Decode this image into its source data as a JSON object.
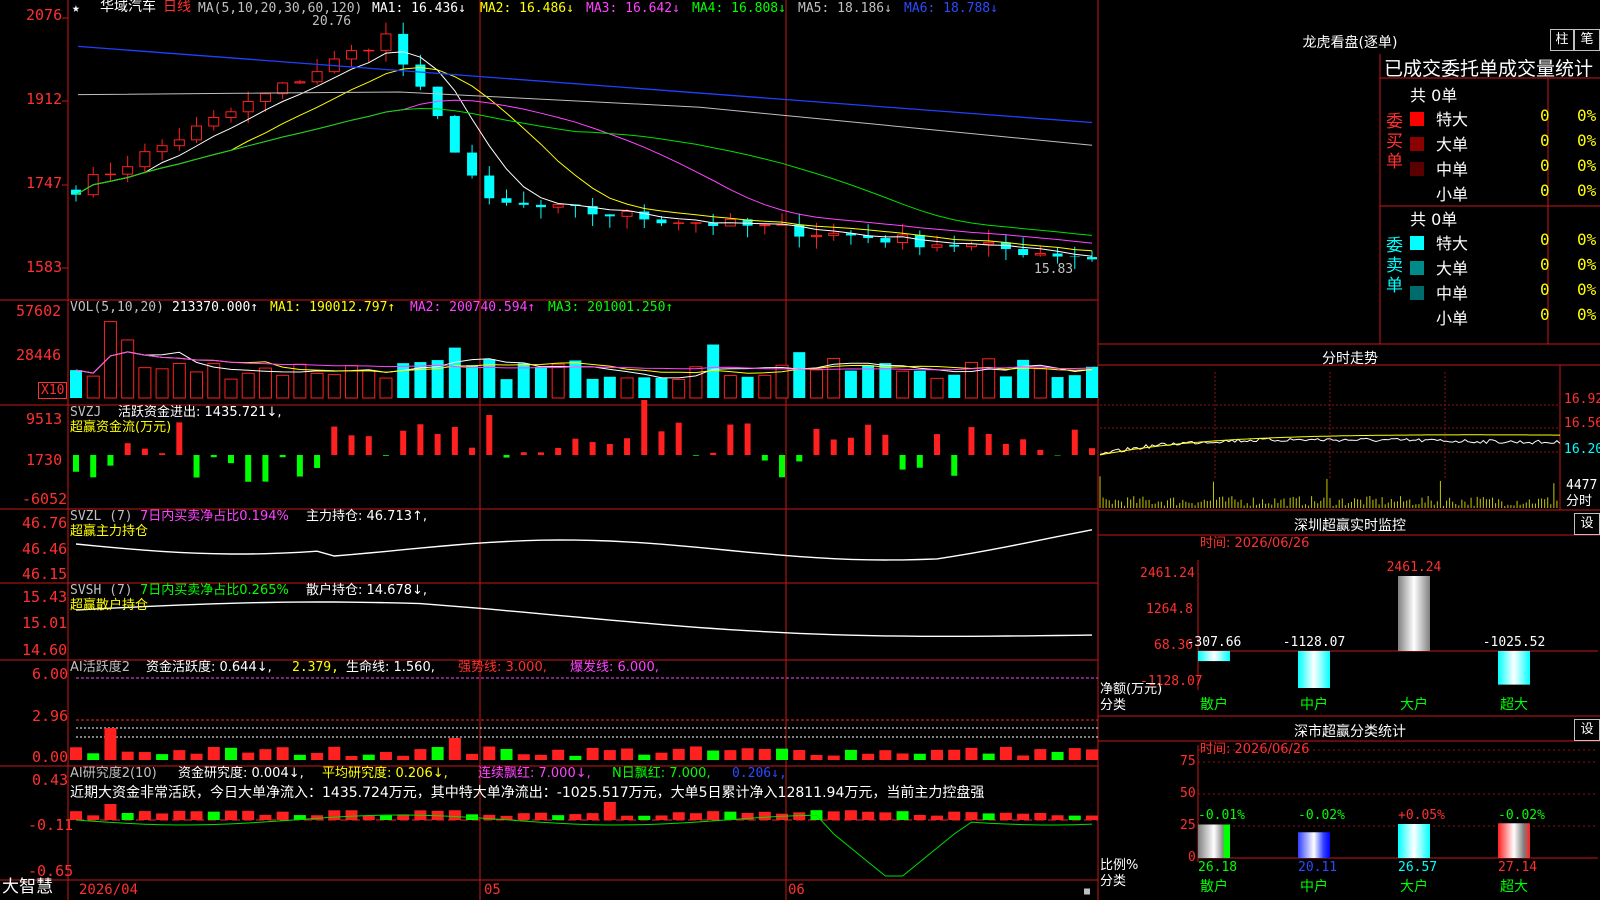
{
  "stock": {
    "star": "★",
    "name": "华域汽车",
    "period": "日线"
  },
  "ma_header": {
    "label": "MA(5,10,20,30,60,120)",
    "ma1": "MA1: 16.436↓",
    "ma2": "MA2: 16.486↓",
    "ma3": "MA3: 16.642↓",
    "ma4": "MA4: 16.808↓",
    "ma5": "MA5: 18.186↓",
    "ma6": "MA6: 18.788↓"
  },
  "price_axis": [
    "2076",
    "1912",
    "1747",
    "1583"
  ],
  "price_annot": {
    "high": "20.76",
    "low": "15.83"
  },
  "vol_header": {
    "label": "VOL(5,10,20)",
    "val": "213370.000↑",
    "ma1": "MA1: 190012.797↑",
    "ma2": "MA2: 200740.594↑",
    "ma3": "MA3: 201001.250↑"
  },
  "vol_axis": [
    "57602",
    "28446"
  ],
  "vol_unit": "X10",
  "svzj": {
    "name": "SVZJ",
    "title": "活跃资金进出: 1435.721↓,",
    "sub": "超赢资金流(万元)",
    "axis": [
      "9513",
      "1730",
      "-6052"
    ]
  },
  "svzl": {
    "name": "SVZL (7)",
    "desc": "7日内买卖净占比0.194%",
    "hold": "主力持仓: 46.713↑,",
    "sub": "超赢主力持仓",
    "axis": [
      "46.76",
      "46.46",
      "46.15"
    ]
  },
  "svsh": {
    "name": "SVSH (7)",
    "desc": "7日内买卖净占比0.265%",
    "hold": "散户持仓: 14.678↓,",
    "sub": "超赢散户持仓",
    "axis": [
      "15.43",
      "15.01",
      "14.60"
    ]
  },
  "ai1": {
    "name": "AI活跃度2",
    "a": "资金活跃度: 0.644↓,",
    "b": "2.379,",
    "c": "生命线: 1.560,",
    "d": "强势线: 3.000,",
    "e": "爆发线: 6.000,",
    "axis": [
      "6.00",
      "2.96",
      "0.00"
    ]
  },
  "ai2": {
    "name": "AI研究度2(10)",
    "a": "资金研究度: 0.004↓,",
    "b": "平均研究度: 0.206↓,",
    "c": "连续飘红: 7.000↓,",
    "d": "N日飘红: 7.000,",
    "e": "0.206↓,",
    "comment": "近期大资金非常活跃，今日大单净流入：1435.724万元，其中特大单净流出：-1025.517万元，大单5日累计净入12811.94万元，当前主力控盘强",
    "axis": [
      "0.43",
      "-0.11",
      "-0.65"
    ]
  },
  "date_axis": {
    "start": "2026/04",
    "m5": "05",
    "m6": "06"
  },
  "brand": "大智慧",
  "dragon": {
    "title": "龙虎看盘(逐单)",
    "btn1": "柱",
    "btn2": "笔",
    "tabs": [
      "已成交",
      "委托单",
      "成交量统计"
    ],
    "buy": {
      "side": "委买单",
      "total": "共 0单",
      "rows": [
        {
          "name": "特大",
          "v": "0",
          "p": "0%",
          "color": "#ff0000"
        },
        {
          "name": "大单",
          "v": "0",
          "p": "0%",
          "color": "#8b0000"
        },
        {
          "name": "中单",
          "v": "0",
          "p": "0%",
          "color": "#5a0000"
        },
        {
          "name": "小单",
          "v": "0",
          "p": "0%",
          "color": "#000000"
        }
      ]
    },
    "sell": {
      "side": "委卖单",
      "total": "共 0单",
      "rows": [
        {
          "name": "特大",
          "v": "0",
          "p": "0%",
          "color": "#00ffff"
        },
        {
          "name": "大单",
          "v": "0",
          "p": "0%",
          "color": "#008b8b"
        },
        {
          "name": "中单",
          "v": "0",
          "p": "0%",
          "color": "#006b6b"
        },
        {
          "name": "小单",
          "v": "0",
          "p": "0%",
          "color": "#000000"
        }
      ]
    }
  },
  "intraday": {
    "title": "分时走势",
    "axis": [
      "16.92",
      "16.56",
      "16.20"
    ],
    "vol": "4477",
    "vol_unit": "分时"
  },
  "monitor": {
    "title": "深圳超赢实时监控",
    "set": "设",
    "time": "时间: 2026/06/26",
    "axis": [
      "2461.24",
      "1264.8",
      "68.36",
      "-1128.07"
    ],
    "ylabel": "净额(万元)",
    "xlabel": "分类",
    "cats": [
      "散户",
      "中户",
      "大户",
      "超大"
    ],
    "values": [
      -307.66,
      -1128.07,
      2461.24,
      -1025.52
    ],
    "vlabels": [
      "-307.66",
      "-1128.07",
      "2461.24",
      "-1025.52"
    ]
  },
  "classstat": {
    "title": "深市超赢分类统计",
    "set": "设",
    "time": "时间: 2026/06/26",
    "axis": [
      "75",
      "50",
      "25",
      "0"
    ],
    "ylabel": "比例%",
    "xlabel": "分类",
    "cats": [
      "散户",
      "中户",
      "大户",
      "超大"
    ],
    "values": [
      26.18,
      20.11,
      26.57,
      27.14
    ],
    "changes": [
      "-0.01%",
      "-0.02%",
      "+0.05%",
      "-0.02%"
    ],
    "vals": [
      "26.18",
      "20.11",
      "26.57",
      "27.14"
    ]
  },
  "chart_data": {
    "type": "bar",
    "title": "深圳超赢实时监控",
    "categories": [
      "散户",
      "中户",
      "大户",
      "超大"
    ],
    "values": [
      -307.66,
      -1128.07,
      2461.24,
      -1025.52
    ],
    "ylabel": "净额(万元)",
    "ylim": [
      -1128.07,
      2461.24
    ]
  }
}
